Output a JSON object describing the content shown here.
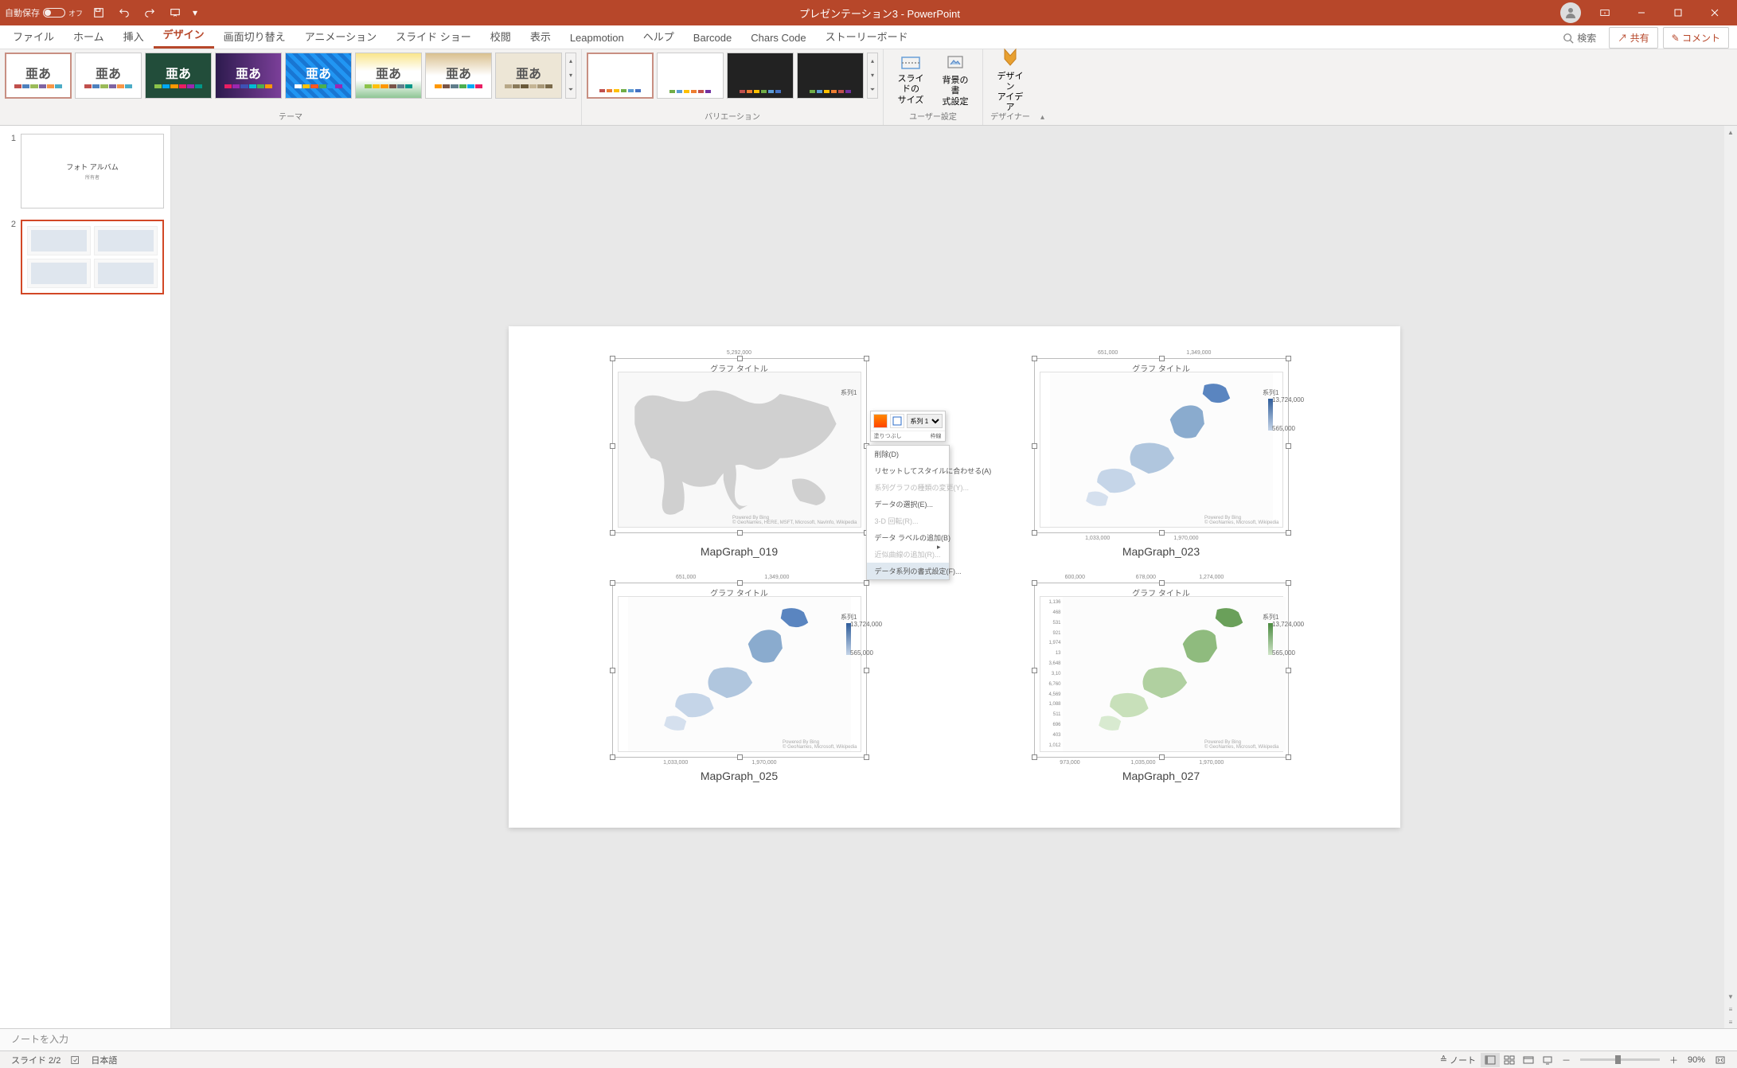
{
  "titlebar": {
    "autosave_label": "自動保存",
    "autosave_state": "オフ",
    "title": "プレゼンテーション3 - PowerPoint"
  },
  "tabs": {
    "file": "ファイル",
    "home": "ホーム",
    "insert": "挿入",
    "design": "デザイン",
    "transitions": "画面切り替え",
    "animations": "アニメーション",
    "slideshow": "スライド ショー",
    "review": "校閲",
    "view": "表示",
    "leapmotion": "Leapmotion",
    "help": "ヘルプ",
    "barcode": "Barcode",
    "charscode": "Chars Code",
    "storyboard": "ストーリーボード",
    "search": "検索",
    "share": "共有",
    "comment": "コメント"
  },
  "ribbon": {
    "theme_text": "亜あ",
    "themes_label": "テーマ",
    "variants_label": "バリエーション",
    "user_label": "ユーザー設定",
    "designer_label": "デザイナー",
    "slide_size": "スライドの\nサイズ",
    "bg_format": "背景の書\n式設定",
    "design_idea": "デザイン\nアイデア"
  },
  "thumbs": {
    "slide1_title": "フォト アルバム",
    "slide1_sub": "所有者"
  },
  "charts": {
    "c1": {
      "title": "グラフ タイトル",
      "caption": "MapGraph_019",
      "top_val": "5,292,000",
      "series": "系列1"
    },
    "c2": {
      "title": "グラフ タイトル",
      "caption": "MapGraph_023",
      "leg_hi": "13,724,000",
      "leg_lo": "565,000",
      "series": "系列1",
      "x1": "651,000",
      "x2": "1,349,000",
      "b1": "1,033,000",
      "b2": "1,970,000"
    },
    "c3": {
      "title": "グラフ タイトル",
      "caption": "MapGraph_025",
      "leg_hi": "13,724,000",
      "leg_lo": "565,000",
      "series": "系列1",
      "x1": "651,000",
      "x2": "1,349,000",
      "b1": "1,033,000",
      "b2": "1,970,000"
    },
    "c4": {
      "title": "グラフ タイトル",
      "caption": "MapGraph_027",
      "leg_hi": "13,724,000",
      "leg_lo": "565,000",
      "series": "系列1",
      "x1": "600,000",
      "x2": "678,000",
      "x3": "1,274,000",
      "y": [
        "1,136",
        "468",
        "531",
        "921",
        "1,974",
        "13",
        "3,648",
        "3,10",
        "6,760",
        "4,569",
        "1,088",
        "511",
        "696",
        "403",
        "1,012"
      ],
      "b1": "973,000",
      "b2": "1,035,000",
      "b3": "1,970,000"
    }
  },
  "context_menu": {
    "fill": "塗りつぶし",
    "outline": "枠線",
    "series_field": "系列 1",
    "delete": "削除(D)",
    "reset": "リセットしてスタイルに合わせる(A)",
    "change_type": "系列グラフの種類の変更(Y)...",
    "select_data": "データの選択(E)...",
    "rotate_3d": "3-D 回転(R)...",
    "add_labels": "データ ラベルの追加(B)",
    "add_trendline": "近似曲線の追加(R)...",
    "format_series": "データ系列の書式設定(F)..."
  },
  "attribution": "Powered By Bing\n© GeoNames, HERE, MSFT, Microsoft, NavInfo, Wikipedia",
  "attribution2": "Powered By Bing\n© GeoNames, Microsoft, Wikipedia",
  "notes": {
    "placeholder": "ノートを入力"
  },
  "statusbar": {
    "slide": "スライド 2/2",
    "lang": "日本語",
    "notes": "ノート",
    "zoom": "90%"
  }
}
